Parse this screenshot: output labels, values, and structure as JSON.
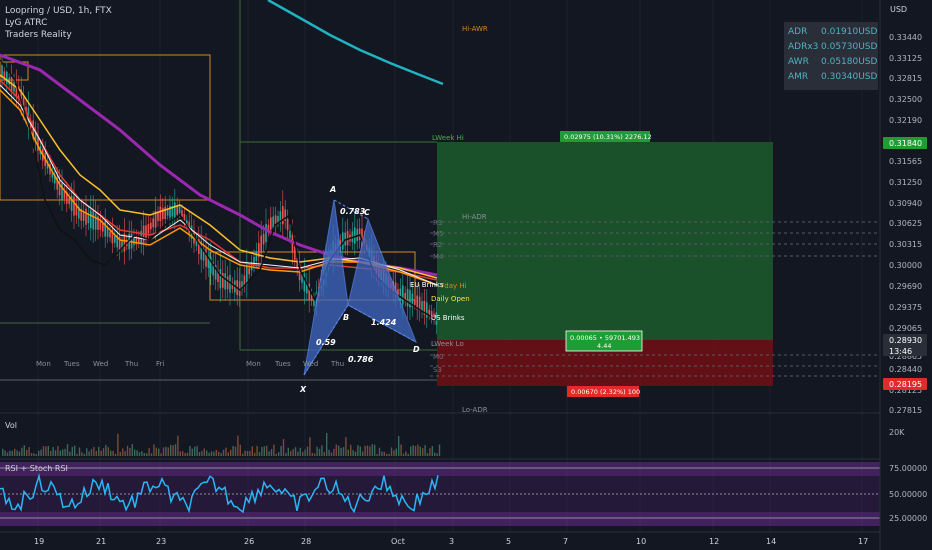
{
  "header": {
    "symbol": "Loopring / USD, 1h, FTX",
    "indicator1": "LyG ATRC",
    "indicator2": "Traders Reality"
  },
  "adr_table": [
    {
      "label": "ADR",
      "value": "0.01910USD"
    },
    {
      "label": "ADRx3",
      "value": "0.05730USD"
    },
    {
      "label": "AWR",
      "value": "0.05180USD"
    },
    {
      "label": "AMR",
      "value": "0.30340USD"
    }
  ],
  "price_axis": {
    "unit": "USD",
    "ticks": [
      "0.33440",
      "0.33125",
      "0.32815",
      "0.32500",
      "0.32190",
      "0.31565",
      "0.31250",
      "0.30940",
      "0.30625",
      "0.30315",
      "0.30000",
      "0.29690",
      "0.29375",
      "0.29065",
      "0.28865",
      "0.28440",
      "0.28125",
      "0.27815"
    ],
    "badges": [
      {
        "value": "0.31840",
        "color": "#1f9d35"
      },
      {
        "value": "0.28930",
        "sub": "13:46",
        "color": "#2a2e39"
      },
      {
        "value": "0.28195",
        "color": "#e22a2a"
      }
    ]
  },
  "time_axis": {
    "ticks": [
      "19",
      "21",
      "23",
      "26",
      "28",
      "Oct",
      "3",
      "5",
      "7",
      "10",
      "12",
      "14",
      "17"
    ],
    "day_labels": [
      "Mon",
      "Tues",
      "Wed",
      "Thu",
      "Fri",
      "Mon",
      "Tues",
      "Wed",
      "Thu"
    ]
  },
  "levels": {
    "hi_awr": "Hi-AWR",
    "lweek_hi": "LWeek Hi",
    "hi_adr": "Hi-ADR",
    "r3": "R3",
    "m5": "M5",
    "r2": "R2",
    "m4": "M4",
    "lo_adr": "Lo-ADR",
    "eu_brinks": "EU Brinks",
    "daily_open": "Daily Open",
    "us_brinks": "US Brinks",
    "lweek_lo": "LWeek Lo",
    "m0": "M0",
    "s3": "S3",
    "yday_hi": "Yday Hi"
  },
  "position": {
    "target_label": "0.02975 (10.31%) 2276.12",
    "entry_label": "0.00065 • 59701.493",
    "entry_sub": "4.44",
    "stop_label": "0.00670 (2.32%) 100"
  },
  "pattern": {
    "points": [
      "X",
      "A",
      "B",
      "C",
      "D"
    ],
    "ratios": [
      "0.783",
      "0.59",
      "1.424",
      "0.786"
    ]
  },
  "volume_pane": {
    "title": "Vol",
    "tick": "20K"
  },
  "rsi_pane": {
    "title": "RSI + Stoch RSI",
    "ticks": [
      "75.00000",
      "50.00000",
      "25.00000"
    ]
  },
  "chart_data": {
    "type": "line",
    "title": "Loopring / USD, 1h, FTX",
    "xlabel": "",
    "ylabel": "USD",
    "ylim": [
      0.2765,
      0.336
    ],
    "harmonic_pattern": [
      {
        "point": "X",
        "price": 0.2818
      },
      {
        "point": "A",
        "price": 0.3098
      },
      {
        "point": "B",
        "price": 0.2932
      },
      {
        "point": "C",
        "price": 0.3075
      },
      {
        "point": "D",
        "price": 0.287
      }
    ],
    "long_position": {
      "entry": 0.2893,
      "target": 0.3184,
      "stop": 0.282
    },
    "rsi_levels": [
      75,
      50,
      25
    ]
  }
}
